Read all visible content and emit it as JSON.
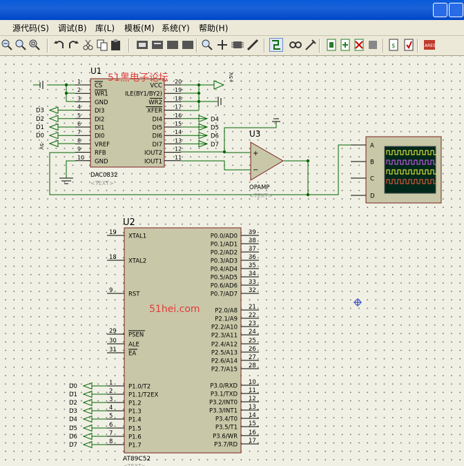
{
  "menu": [
    "源代码(S)",
    "调试(B)",
    "库(L)",
    "模板(M)",
    "系统(Y)",
    "帮助(H)"
  ],
  "watermark_top": "51黑电子论坛",
  "watermark_center": "51hei.com",
  "u1": {
    "ref": "U1",
    "part": "DAC0832",
    "text": "<TEXT>",
    "left_pins": [
      {
        "num": "1",
        "name": "CS"
      },
      {
        "num": "2",
        "name": "WR1"
      },
      {
        "num": "3",
        "name": "GND"
      },
      {
        "num": "4",
        "name": "DI3"
      },
      {
        "num": "5",
        "name": "DI2"
      },
      {
        "num": "6",
        "name": "DI1"
      },
      {
        "num": "7",
        "name": "DI0"
      },
      {
        "num": "8",
        "name": "VREF"
      },
      {
        "num": "9",
        "name": "RFB"
      },
      {
        "num": "10",
        "name": "GND"
      }
    ],
    "right_pins": [
      {
        "num": "20",
        "name": "VCC"
      },
      {
        "num": "19",
        "name": "ILE(BY1/BY2)"
      },
      {
        "num": "18",
        "name": "WR2"
      },
      {
        "num": "17",
        "name": "XFER"
      },
      {
        "num": "16",
        "name": "DI4"
      },
      {
        "num": "15",
        "name": "DI5"
      },
      {
        "num": "14",
        "name": "DI6"
      },
      {
        "num": "13",
        "name": "DI7"
      },
      {
        "num": "12",
        "name": "IOUT2"
      },
      {
        "num": "11",
        "name": "IOUT1"
      }
    ],
    "left_terms": [
      "D3",
      "D2",
      "D1",
      "D0"
    ],
    "right_terms": [
      "D4",
      "D5",
      "D6",
      "D7"
    ],
    "supply_label": "+5V",
    "vref_label": "-5V"
  },
  "u3": {
    "ref": "U3",
    "part": "OPAMP",
    "text": "<TEXT>",
    "plus": "+",
    "minus": "−"
  },
  "scope": {
    "channels": [
      "A",
      "B",
      "C",
      "D"
    ]
  },
  "u2": {
    "ref": "U2",
    "part": "AT89C52",
    "text": "<TEXT>",
    "left_pins": [
      {
        "num": "19",
        "name": "XTAL1"
      },
      {
        "num": "18",
        "name": "XTAL2"
      },
      {
        "num": "9",
        "name": "RST"
      },
      {
        "num": "29",
        "name": "PSEN"
      },
      {
        "num": "30",
        "name": "ALE"
      },
      {
        "num": "31",
        "name": "EA"
      },
      {
        "num": "1",
        "name": "P1.0/T2"
      },
      {
        "num": "2",
        "name": "P1.1/T2EX"
      },
      {
        "num": "3",
        "name": "P1.2"
      },
      {
        "num": "4",
        "name": "P1.3"
      },
      {
        "num": "5",
        "name": "P1.4"
      },
      {
        "num": "6",
        "name": "P1.5"
      },
      {
        "num": "7",
        "name": "P1.6"
      },
      {
        "num": "8",
        "name": "P1.7"
      }
    ],
    "right_pins": [
      {
        "num": "39",
        "name": "P0.0/AD0"
      },
      {
        "num": "38",
        "name": "P0.1/AD1"
      },
      {
        "num": "37",
        "name": "P0.2/AD2"
      },
      {
        "num": "36",
        "name": "P0.3/AD3"
      },
      {
        "num": "35",
        "name": "P0.4/AD4"
      },
      {
        "num": "34",
        "name": "P0.5/AD5"
      },
      {
        "num": "33",
        "name": "P0.6/AD6"
      },
      {
        "num": "32",
        "name": "P0.7/AD7"
      },
      {
        "num": "21",
        "name": "P2.0/A8"
      },
      {
        "num": "22",
        "name": "P2.1/A9"
      },
      {
        "num": "23",
        "name": "P2.2/A10"
      },
      {
        "num": "24",
        "name": "P2.3/A11"
      },
      {
        "num": "25",
        "name": "P2.4/A12"
      },
      {
        "num": "26",
        "name": "P2.5/A13"
      },
      {
        "num": "27",
        "name": "P2.6/A14"
      },
      {
        "num": "28",
        "name": "P2.7/A15"
      },
      {
        "num": "10",
        "name": "P3.0/RXD"
      },
      {
        "num": "11",
        "name": "P3.1/TXD"
      },
      {
        "num": "12",
        "name": "P3.2/INT0"
      },
      {
        "num": "13",
        "name": "P3.3/INT1"
      },
      {
        "num": "14",
        "name": "P3.4/T0"
      },
      {
        "num": "15",
        "name": "P3.5/T1"
      },
      {
        "num": "16",
        "name": "P3.6/WR"
      },
      {
        "num": "17",
        "name": "P3.7/RD"
      }
    ],
    "port_terms": [
      "D0",
      "D1",
      "D2",
      "D3",
      "D4",
      "D5",
      "D6",
      "D7"
    ]
  },
  "colors": {
    "wire": "#006400",
    "body": "#c8c8a8",
    "outline": "#7a1f1f",
    "pin_text": "#000000",
    "watermark": "#e23a3a"
  }
}
